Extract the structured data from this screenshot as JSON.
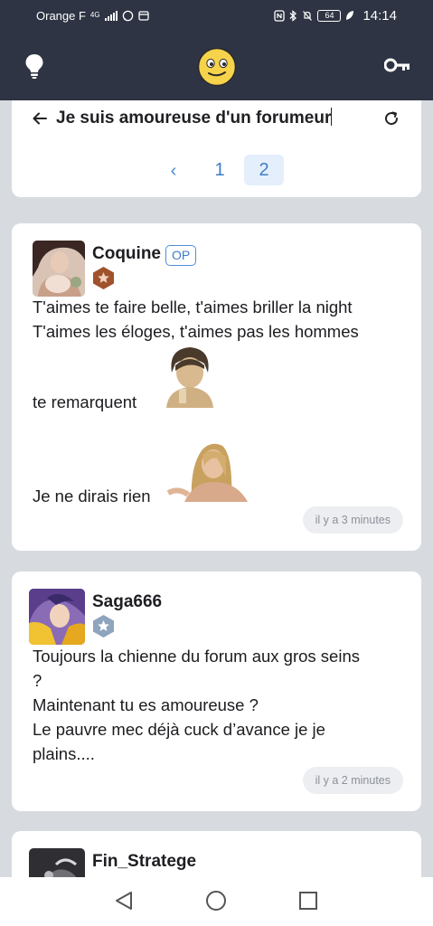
{
  "status_bar": {
    "carrier": "Orange F",
    "network_type": "4G",
    "battery_level": "64",
    "time": "14:14"
  },
  "header": {
    "bulb_icon": "lightbulb-icon",
    "logo_icon": "smiley-logo-icon",
    "key_icon": "key-icon"
  },
  "topic": {
    "title": "Je suis amoureuse d'un forumeur",
    "back_icon": "arrow-left-icon",
    "refresh_icon": "refresh-icon",
    "pagination": {
      "prev": "‹",
      "pages": [
        "1",
        "2"
      ],
      "current_page": "2"
    }
  },
  "posts": [
    {
      "author": "Coquine",
      "op_label": "OP",
      "rank_color": "#a0522d",
      "lines": [
        "T'aimes te faire belle, t'aimes briller la night",
        "T'aimes les éloges, t'aimes pas les hommes",
        "te remarquent",
        "Je ne dirais rien"
      ],
      "time": "il y a 3 minutes"
    },
    {
      "author": "Saga666",
      "rank_color": "#8fa4bd",
      "lines": [
        "Toujours la chienne du forum aux gros seins",
        "?",
        "Maintenant tu es amoureuse ?",
        "Le pauvre mec déjà cuck d’avance je je",
        "plains...."
      ],
      "time": "il y a 2 minutes"
    },
    {
      "author": "Fin_Stratege"
    }
  ],
  "colors": {
    "header_bg": "#2e3443",
    "page_bg": "#d7dbe0",
    "accent_blue": "#3e7cc7"
  }
}
